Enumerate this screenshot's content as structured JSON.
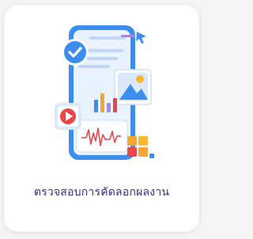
{
  "card": {
    "label": "ตรวจสอบการคัดลอกผลงาน",
    "illustration_icons": [
      "phone-document-icon",
      "check-badge-icon",
      "cursor-icon",
      "image-icon",
      "bar-chart-icon",
      "play-video-icon",
      "waveform-chart-icon",
      "grid-apps-icon"
    ]
  },
  "colors": {
    "label_text": "#3a2f7a",
    "primary_blue": "#3b8ef0",
    "light_blue": "#dbe9ff",
    "accent_red": "#e8474a",
    "accent_orange": "#f7a531",
    "accent_purple": "#a986e6"
  }
}
